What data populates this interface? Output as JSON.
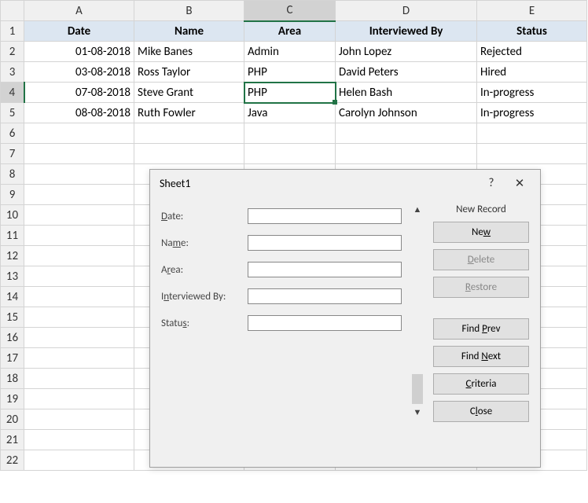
{
  "columns": [
    "A",
    "B",
    "C",
    "D",
    "E"
  ],
  "row_numbers": [
    "1",
    "2",
    "3",
    "4",
    "5",
    "6",
    "7",
    "8",
    "9",
    "10",
    "11",
    "12",
    "13",
    "14",
    "15",
    "16",
    "17",
    "18",
    "19",
    "20",
    "21",
    "22"
  ],
  "headers": {
    "a": "Date",
    "b": "Name",
    "c": "Area",
    "d": "Interviewed By",
    "e": "Status"
  },
  "rows": [
    {
      "a": "01-08-2018",
      "b": "Mike Banes",
      "c": "Admin",
      "d": "John Lopez",
      "e": "Rejected"
    },
    {
      "a": "03-08-2018",
      "b": "Ross Taylor",
      "c": "PHP",
      "d": "David Peters",
      "e": "Hired"
    },
    {
      "a": "07-08-2018",
      "b": "Steve Grant",
      "c": "PHP",
      "d": "Helen Bash",
      "e": "In-progress"
    },
    {
      "a": "08-08-2018",
      "b": "Ruth Fowler",
      "c": "Java",
      "d": "Carolyn Johnson",
      "e": "In-progress"
    }
  ],
  "selected_col": "C",
  "selected_row": "4",
  "dialog": {
    "title": "Sheet1",
    "help": "?",
    "close": "✕",
    "labels": {
      "date_pre": "D",
      "date_post": "ate:",
      "name_pre": "Na",
      "name_u": "m",
      "name_post": "e:",
      "area_pre": "A",
      "area_u": "r",
      "area_post": "ea:",
      "int_pre": "I",
      "int_u": "n",
      "int_post": "terviewed By:",
      "status_pre": "Statu",
      "status_u": "s",
      "status_post": ":"
    },
    "fields": {
      "date": "",
      "name": "",
      "area": "",
      "interviewed": "",
      "status": ""
    },
    "status_text": "New Record",
    "buttons": {
      "new": "w",
      "new_pre": "Ne",
      "delete": "D",
      "delete_post": "elete",
      "restore": "R",
      "restore_post": "estore",
      "findprev": "P",
      "findprev_pre": "Find ",
      "findprev_post": "rev",
      "findnext": "N",
      "findnext_pre": "Find ",
      "findnext_post": "ext",
      "criteria": "C",
      "criteria_post": "riteria",
      "close": "l",
      "close_pre": "C",
      "close_post": "ose"
    },
    "scroll": {
      "up": "▲",
      "down": "▼"
    }
  }
}
